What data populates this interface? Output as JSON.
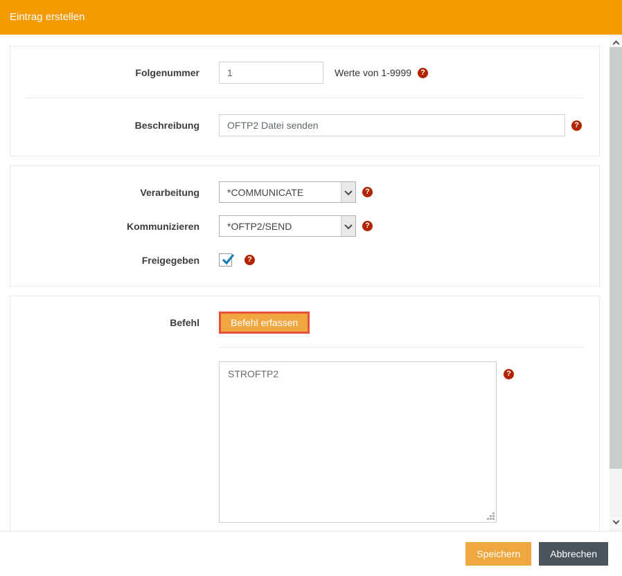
{
  "window": {
    "title": "Eintrag erstellen"
  },
  "colors": {
    "header_bg": "#f59b00",
    "accent_orange": "#f0a73f",
    "highlight_border_red": "#e8503c",
    "help_icon_red": "#b22400",
    "dark_button": "#49545c",
    "checkbox_check_blue": "#1d7db9"
  },
  "icons": {
    "help_glyph": "?"
  },
  "fields": {
    "folgenummer": {
      "label": "Folgenummer",
      "value": "1",
      "hint": "Werte von 1-9999"
    },
    "beschreibung": {
      "label": "Beschreibung",
      "value": "OFTP2 Datei senden"
    },
    "verarbeitung": {
      "label": "Verarbeitung",
      "value": "*COMMUNICATE"
    },
    "kommunizieren": {
      "label": "Kommunizieren",
      "value": "*OFTP2/SEND"
    },
    "freigegeben": {
      "label": "Freigegeben",
      "checked": true
    },
    "befehl": {
      "label": "Befehl",
      "button_label": "Befehl erfassen",
      "command_value": "STROFTP2"
    }
  },
  "footer": {
    "save_label": "Speichern",
    "cancel_label": "Abbrechen"
  }
}
